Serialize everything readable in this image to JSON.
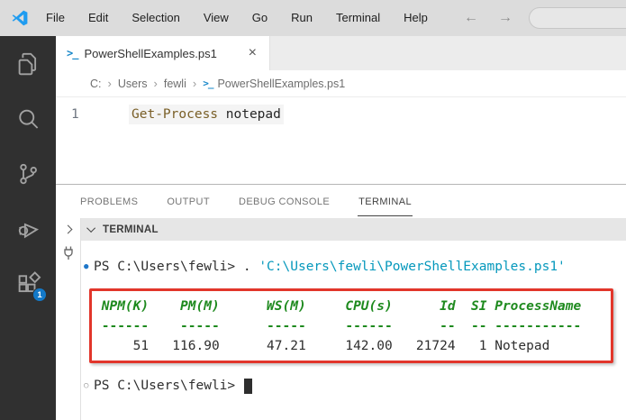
{
  "titlebar": {
    "menu": [
      "File",
      "Edit",
      "Selection",
      "View",
      "Go",
      "Run",
      "Terminal",
      "Help"
    ],
    "back_arrow": "←",
    "forward_arrow": "→",
    "search_placeholder": ""
  },
  "activity_bar": {
    "items": [
      "explorer",
      "search",
      "source-control",
      "run-and-debug",
      "extensions"
    ],
    "extensions_badge": "1"
  },
  "editor": {
    "tab": {
      "ps_icon": ">_",
      "label": "PowerShellExamples.ps1",
      "close": "×"
    },
    "breadcrumb": {
      "separator": "›",
      "segments": [
        "C:",
        "Users",
        "fewli"
      ],
      "file_ps_icon": ">_",
      "file": "PowerShellExamples.ps1"
    },
    "line_number": "1",
    "code": {
      "cmdlet": "Get-Process",
      "argument": " notepad"
    }
  },
  "panel": {
    "tabs": [
      "PROBLEMS",
      "OUTPUT",
      "DEBUG CONSOLE",
      "TERMINAL"
    ],
    "active_tab": "TERMINAL",
    "section_title": "TERMINAL"
  },
  "terminal": {
    "command_line": {
      "marker": "●",
      "prefix": "PS C:\\Users\\fewli> . ",
      "script_path": "'C:\\Users\\fewli\\PowerShellExamples.ps1'"
    },
    "table": {
      "header_line": " NPM(K)    PM(M)      WS(M)     CPU(s)      Id  SI ProcessName",
      "dashes_line": " ------    -----      -----     ------      --  -- -----------",
      "values_line": "     51   116.90      47.21     142.00   21724   1 Notepad",
      "columns": [
        "NPM(K)",
        "PM(M)",
        "WS(M)",
        "CPU(s)",
        "Id",
        "SI",
        "ProcessName"
      ],
      "row": {
        "npm_k": "51",
        "pm_m": "116.90",
        "ws_m": "47.21",
        "cpu_s": "142.00",
        "id": "21724",
        "si": "1",
        "process_name": "Notepad"
      }
    },
    "prompt_line": {
      "marker": "○",
      "prompt": "PS C:\\Users\\fewli> "
    }
  },
  "colors": {
    "annotation_red": "#e2362b",
    "table_green": "#1e8a1e",
    "string_teal": "#0598bc",
    "badge_blue": "#1379c8",
    "marker_blue": "#1f77c9",
    "cmdlet_brown": "#795E26",
    "titlebar_gray": "#dcdcdc",
    "activitybar_dark": "#303030"
  }
}
